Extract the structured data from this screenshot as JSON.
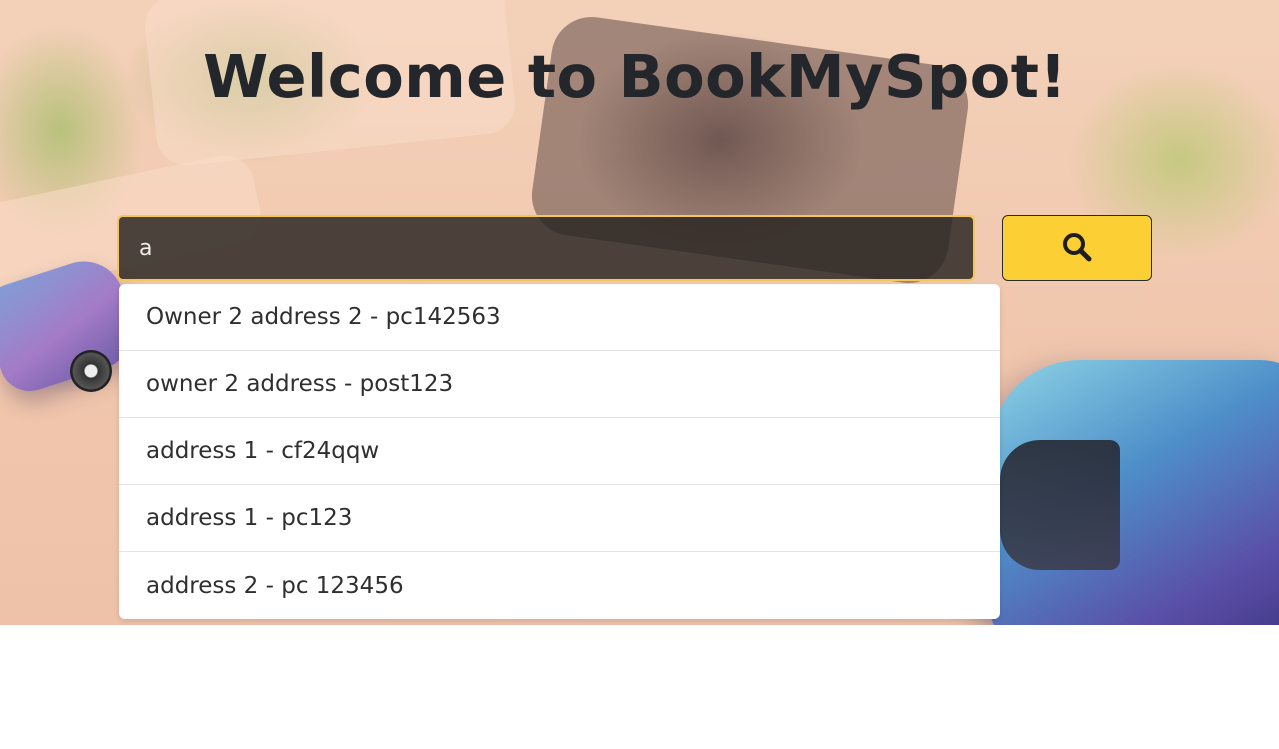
{
  "header": {
    "title": "Welcome to BookMySpot!"
  },
  "search": {
    "value": "a",
    "button_icon": "search-icon"
  },
  "suggestions": [
    {
      "label": "Owner 2 address 2 - pc142563"
    },
    {
      "label": "owner 2 address - post123"
    },
    {
      "label": "address 1 - cf24qqw"
    },
    {
      "label": "address 1 - pc123"
    },
    {
      "label": "address 2 - pc 123456"
    }
  ],
  "colors": {
    "accent": "#fccf35",
    "title": "#23262b",
    "input_bg": "#2a2624",
    "input_border": "#f3c55a"
  }
}
